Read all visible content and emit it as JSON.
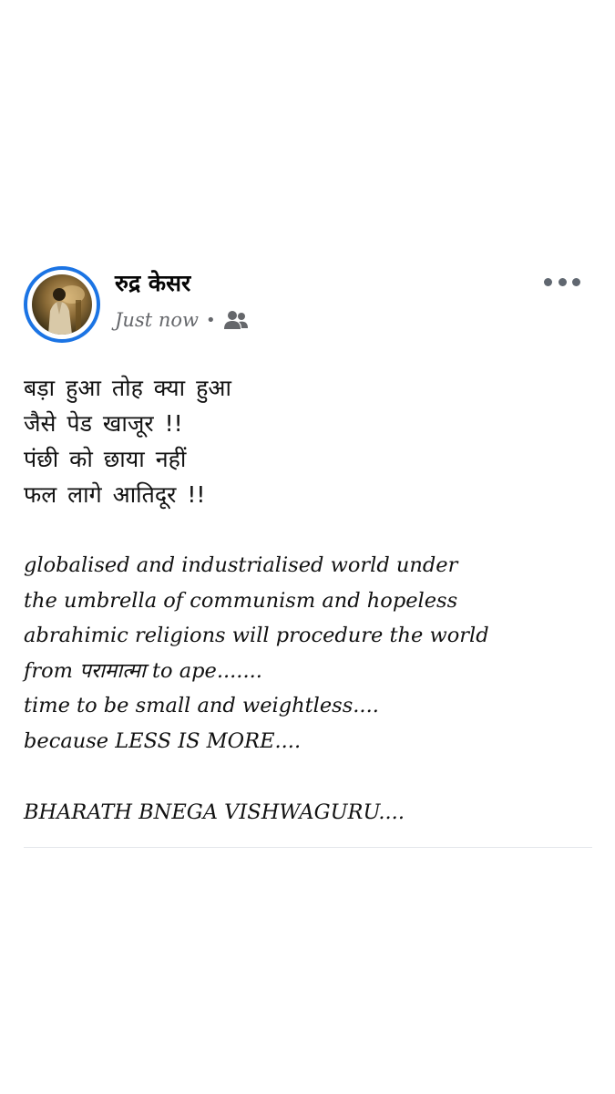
{
  "post": {
    "author": {
      "name": "रुद्र केसर",
      "avatar_icon": "profile-photo"
    },
    "meta": {
      "time": "Just now",
      "separator": "•",
      "audience_icon": "friends-icon"
    },
    "more_icon": "more-horizontal-icon",
    "text_lines": {
      "l1": "बड़ा हुआ तोह क्या हुआ",
      "l2": "जैसे पेड खाजूर !!",
      "l3": "पंछी को छाया नहीं",
      "l4": "फल लागे आतिदूर !!",
      "l5": "globalised and industrialised world under",
      "l6": "the umbrella of communism and hopeless",
      "l7": "abrahimic religions will procedure the world",
      "l8": "from परामात्मा to ape.......",
      "l9": "time to be small and weightless....",
      "l10": "because LESS IS MORE....",
      "l11": "BHARATH BNEGA VISHWAGURU...."
    },
    "colors": {
      "ring": "#1b74e4",
      "secondary_text": "#65676b",
      "divider": "#e4e6eb"
    }
  }
}
